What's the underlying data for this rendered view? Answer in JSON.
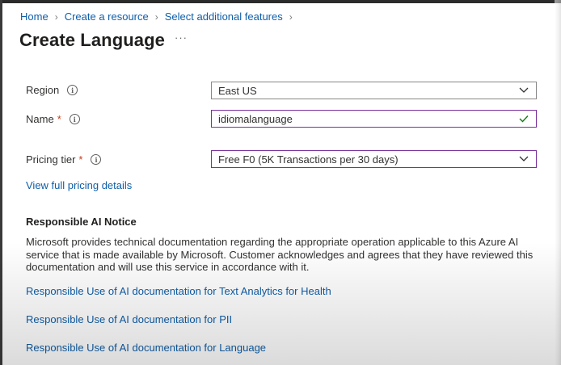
{
  "breadcrumb": {
    "items": [
      "Home",
      "Create a resource",
      "Select additional features"
    ]
  },
  "header": {
    "title": "Create Language",
    "more_label": "···"
  },
  "form": {
    "region": {
      "label": "Region",
      "value": "East US"
    },
    "name": {
      "label": "Name",
      "required_mark": "*",
      "value": "idiomalanguage",
      "validation": "valid"
    },
    "pricing_tier": {
      "label": "Pricing tier",
      "required_mark": "*",
      "value": "Free F0 (5K Transactions per 30 days)"
    },
    "pricing_link": "View full pricing details"
  },
  "responsible_ai": {
    "heading": "Responsible AI Notice",
    "notice": "Microsoft provides technical documentation regarding the appropriate operation applicable to this Azure AI service that is made available by Microsoft. Customer acknowledges and agrees that they have reviewed this documentation and will use this service in accordance with it.",
    "links": [
      "Responsible Use of AI documentation for Text Analytics for Health",
      "Responsible Use of AI documentation for PII",
      "Responsible Use of AI documentation for Language"
    ]
  },
  "icons": {
    "info": "info-icon",
    "chevron": "chevron-down-icon",
    "check": "check-icon",
    "separator": "chevron-right-icon",
    "more": "more-icon"
  },
  "colors": {
    "link": "#0f5ea8",
    "required": "#c43e1c",
    "focus_border": "#7a2f9c",
    "valid_check": "#107c10"
  }
}
